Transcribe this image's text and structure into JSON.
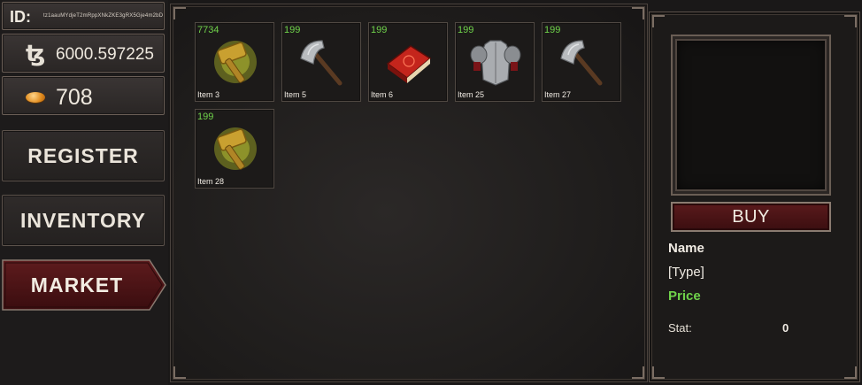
{
  "sidebar": {
    "id_label": "ID:",
    "id_value": "tz1aauMYdjeT2mRppXNkZKE3gRX5Gje4m2bD",
    "tez_icon": "tezos-icon",
    "tez_symbol": "ꜩ",
    "tez_balance": "6000.597225",
    "coin_icon": "gold-coin-icon",
    "coin_balance": "708",
    "nav": {
      "register": "REGISTER",
      "inventory": "INVENTORY",
      "market": "MARKET"
    },
    "active_nav": "market"
  },
  "market": {
    "items": [
      {
        "qty": "7734",
        "name": "Item 3",
        "icon": "golden-hammer-icon"
      },
      {
        "qty": "199",
        "name": "Item 5",
        "icon": "battle-axe-icon"
      },
      {
        "qty": "199",
        "name": "Item 6",
        "icon": "red-spellbook-icon"
      },
      {
        "qty": "199",
        "name": "Item 25",
        "icon": "chest-armor-icon"
      },
      {
        "qty": "199",
        "name": "Item 27",
        "icon": "battle-axe-icon"
      },
      {
        "qty": "199",
        "name": "Item 28",
        "icon": "golden-hammer-icon"
      }
    ]
  },
  "detail": {
    "buy_label": "BUY",
    "name": "Name",
    "type": "[Type]",
    "price": "Price",
    "stat_label": "Stat:",
    "stat_value": "0"
  },
  "colors": {
    "quantity_green": "#6fd24a",
    "market_red": "#5a1a1c"
  }
}
